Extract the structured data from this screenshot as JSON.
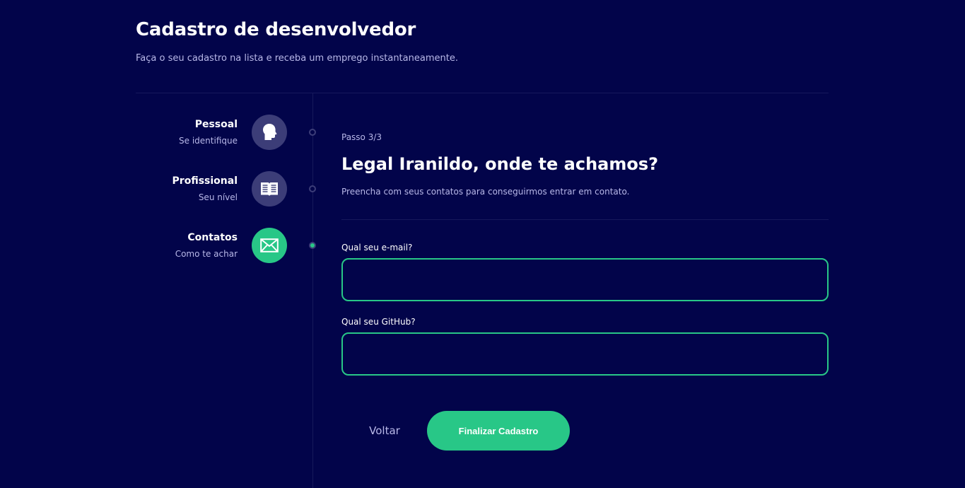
{
  "header": {
    "title": "Cadastro de desenvolvedor",
    "subtitle": "Faça o seu cadastro na lista e receba um emprego instantaneamente."
  },
  "steps": [
    {
      "title": "Pessoal",
      "subtitle": "Se identifique",
      "icon": "person-head-icon",
      "active": false
    },
    {
      "title": "Profissional",
      "subtitle": "Seu nível",
      "icon": "book-icon",
      "active": false
    },
    {
      "title": "Contatos",
      "subtitle": "Como te achar",
      "icon": "mail-icon",
      "active": true
    }
  ],
  "main": {
    "step_counter": "Passo 3/3",
    "heading": "Legal Iranildo, onde te achamos?",
    "description": "Preencha com seus contatos para conseguirmos entrar em contato.",
    "email": {
      "label": "Qual seu e-mail?",
      "value": ""
    },
    "github": {
      "label": "Qual seu GitHub?",
      "value": ""
    }
  },
  "actions": {
    "back_label": "Voltar",
    "finish_label": "Finalizar Cadastro"
  },
  "colors": {
    "background": "#02044a",
    "accent": "#28c787",
    "inactive": "#3c3d78",
    "muted_text": "#b8b8e8",
    "divider": "#16195b"
  }
}
